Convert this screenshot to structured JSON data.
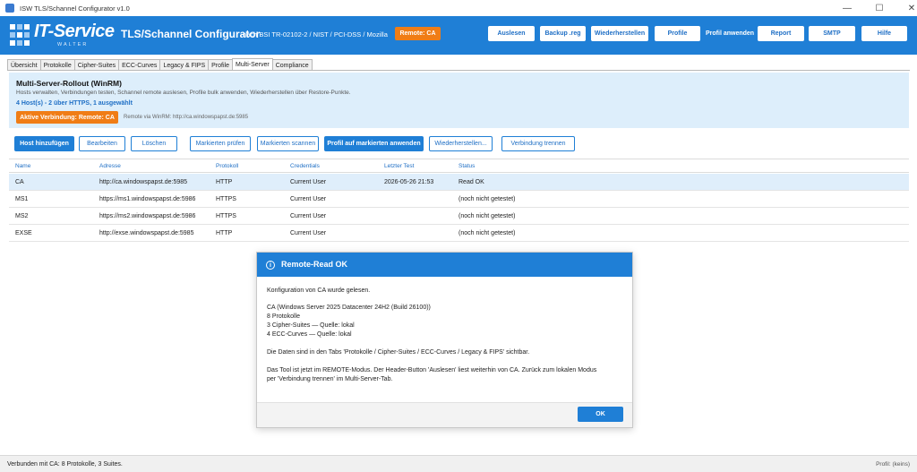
{
  "window": {
    "title": "ISW TLS/Schannel Configurator v1.0",
    "controls": {
      "minimize": "—",
      "maximize": "☐",
      "close": "✕"
    }
  },
  "header": {
    "brand": "IT-Service",
    "brand_sub": "WALTER",
    "title": "TLS/Schannel Configurator",
    "subtitle": "nach BSI TR-02102-2 / NIST / PCI-DSS / Mozilla",
    "remote_badge": "Remote: CA",
    "buttons": {
      "auslesen": "Auslesen",
      "backup": "Backup .reg",
      "wiederherstellen": "Wiederherstellen",
      "profile": "Profile",
      "profil_anwenden": "Profil anwenden",
      "report": "Report",
      "smtp": "SMTP",
      "hilfe": "Hilfe"
    },
    "accent_color": "#1f7fd6",
    "badge_color": "#f07d16"
  },
  "tabs": [
    "Übersicht",
    "Protokolle",
    "Cipher-Suites",
    "ECC-Curves",
    "Legacy & FIPS",
    "Profile",
    "Multi-Server",
    "Compliance"
  ],
  "active_tab": "Multi-Server",
  "multi_server": {
    "title": "Multi-Server-Rollout (WinRM)",
    "description": "Hosts verwalten, Verbindungen testen, Schannel remote auslesen, Profile bulk anwenden, Wiederherstellen über Restore-Punkte.",
    "host_count": "4 Host(s) - 2 über HTTPS, 1 ausgewählt",
    "active_connection": "Aktive Verbindung:  Remote: CA",
    "connection_note": "Remote via WinRM: http://ca.windowspapst.de:5985"
  },
  "actions": {
    "host_hinzufuegen": "Host hinzufügen",
    "bearbeiten": "Bearbeiten",
    "loeschen": "Löschen",
    "markierten_pruefen": "Markierten prüfen",
    "markierten_scannen": "Markierten scannen",
    "profil_auf_markierten": "Profil auf markierten anwenden",
    "wiederherstellen": "Wiederherstellen...",
    "verbindung_trennen": "Verbindung trennen"
  },
  "table": {
    "columns": [
      "Name",
      "Adresse",
      "Protokoll",
      "Credentials",
      "Letzter Test",
      "Status"
    ],
    "rows": [
      [
        "CA",
        "http://ca.windowspapst.de:5985",
        "HTTP",
        "Current User",
        "2026-05-26 21:53",
        "Read OK"
      ],
      [
        "MS1",
        "https://ms1.windowspapst.de:5986",
        "HTTPS",
        "Current User",
        "",
        "(noch nicht getestet)"
      ],
      [
        "MS2",
        "https://ms2.windowspapst.de:5986",
        "HTTPS",
        "Current User",
        "",
        "(noch nicht getestet)"
      ],
      [
        "EXSE",
        "http://exse.windowspapst.de:5985",
        "HTTP",
        "Current User",
        "",
        "(noch nicht getestet)"
      ]
    ],
    "selected_row": 0
  },
  "dialog": {
    "title": "Remote-Read OK",
    "icon": "info-icon",
    "lines": {
      "l1": "Konfiguration von CA wurde gelesen.",
      "l2": "CA (Windows Server 2025 Datacenter 24H2 (Build 26100))",
      "l3": "8 Protokolle",
      "l4": "3 Cipher-Suites — Quelle: lokal",
      "l5": "4 ECC-Curves — Quelle: lokal",
      "l6": "Die Daten sind in den Tabs 'Protokolle / Cipher-Suites / ECC-Curves / Legacy & FIPS' sichtbar.",
      "l7": "Das Tool ist jetzt im REMOTE-Modus. Der Header-Button 'Auslesen' liest weiterhin von CA. Zurück zum lokalen Modus",
      "l8": "per 'Verbindung trennen' im Multi-Server-Tab."
    },
    "ok": "OK"
  },
  "status": {
    "left": "Verbunden mit CA: 8 Protokolle, 3 Suites.",
    "right": "Profil: (keins)"
  }
}
